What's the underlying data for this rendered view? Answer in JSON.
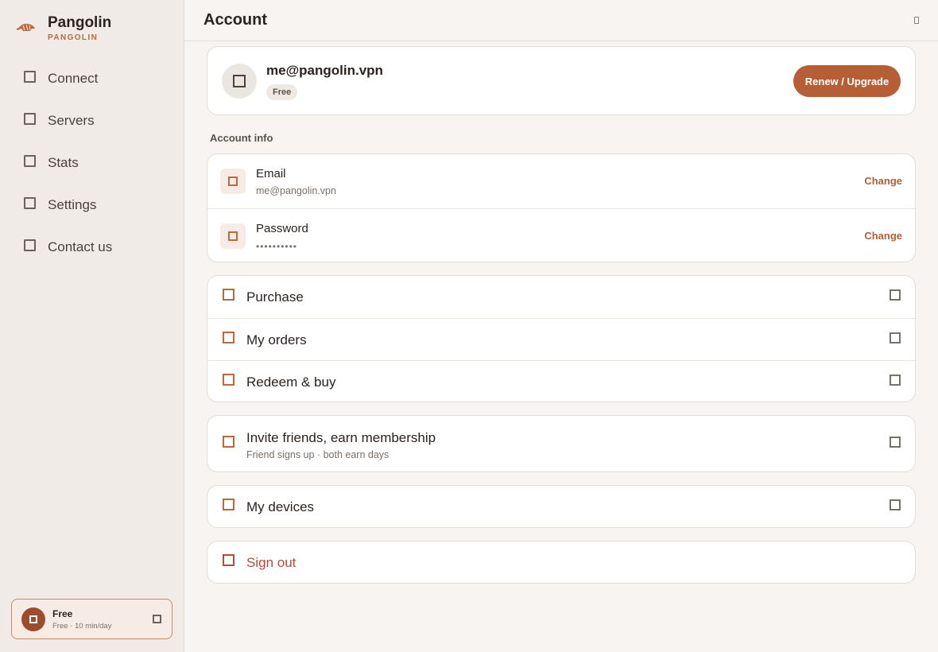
{
  "app": {
    "name": "Pangolin",
    "subtitle": "PANGOLIN"
  },
  "sidebar": {
    "items": [
      {
        "label": "Connect",
        "icon": "connect-icon"
      },
      {
        "label": "Servers",
        "icon": "servers-icon"
      },
      {
        "label": "Stats",
        "icon": "stats-icon"
      },
      {
        "label": "Settings",
        "icon": "settings-icon"
      },
      {
        "label": "Contact us",
        "icon": "contact-icon"
      }
    ],
    "plan": {
      "title": "Free",
      "subtitle": "Free · 10 min/day"
    }
  },
  "header": {
    "title": "Account"
  },
  "profile": {
    "email": "me@pangolin.vpn",
    "badge": "Free",
    "action_label": "Renew / Upgrade"
  },
  "account_info": {
    "section_label": "Account info",
    "rows": [
      {
        "title": "Email",
        "value": "me@pangolin.vpn",
        "action": "Change"
      },
      {
        "title": "Password",
        "value": "••••••••••",
        "action": "Change"
      }
    ]
  },
  "purchase_list": [
    {
      "label": "Purchase"
    },
    {
      "label": "My orders"
    },
    {
      "label": "Redeem & buy"
    }
  ],
  "invite": {
    "label": "Invite friends, earn membership",
    "subtitle": "Friend signs up · both earn days"
  },
  "devices": {
    "label": "My devices"
  },
  "signout": {
    "label": "Sign out"
  },
  "colors": {
    "accent": "#b65e36",
    "danger": "#b84a3a",
    "sidebar_bg": "#f0ebe6",
    "page_bg": "#f7f4f1"
  }
}
